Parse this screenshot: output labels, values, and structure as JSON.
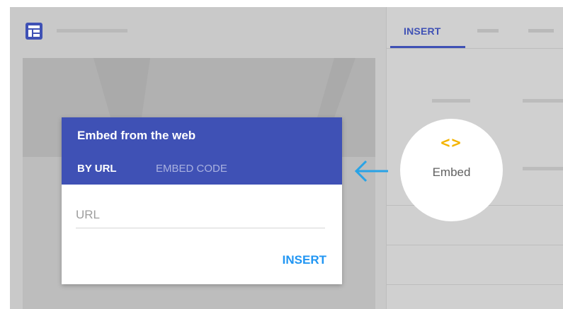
{
  "toolbar": {
    "app_icon": "layout-icon"
  },
  "panel": {
    "tabs": [
      {
        "label": "INSERT",
        "active": true
      }
    ],
    "embed_item": {
      "icon": "code-brackets-icon",
      "glyph": "<>",
      "label": "Embed"
    }
  },
  "dialog": {
    "title": "Embed from the web",
    "tabs": [
      {
        "label": "BY URL",
        "active": true
      },
      {
        "label": "EMBED CODE",
        "active": false
      }
    ],
    "url_field": {
      "placeholder": "URL",
      "value": ""
    },
    "insert_label": "INSERT"
  },
  "colors": {
    "accent": "#3f51b5",
    "link": "#2196f3",
    "embed_icon": "#f4b400",
    "arrow": "#29a3e6"
  }
}
